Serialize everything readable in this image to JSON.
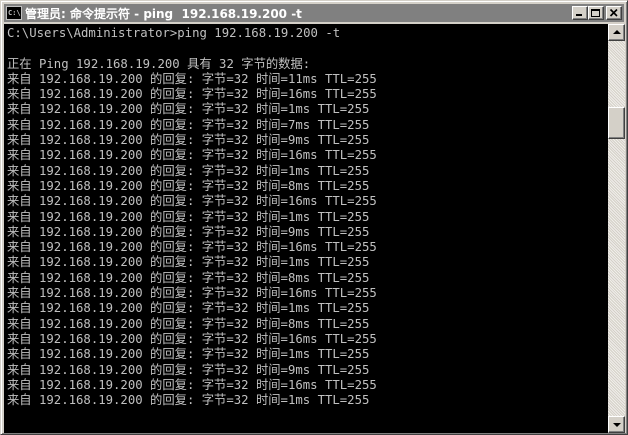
{
  "window": {
    "icon_text": "C:\\",
    "title": "管理员: 命令提示符 - ping  192.168.19.200 -t"
  },
  "console": {
    "lines": [
      "C:\\Users\\Administrator>ping 192.168.19.200 -t",
      "",
      "正在 Ping 192.168.19.200 具有 32 字节的数据:",
      "来自 192.168.19.200 的回复: 字节=32 时间=11ms TTL=255",
      "来自 192.168.19.200 的回复: 字节=32 时间=16ms TTL=255",
      "来自 192.168.19.200 的回复: 字节=32 时间=1ms TTL=255",
      "来自 192.168.19.200 的回复: 字节=32 时间=7ms TTL=255",
      "来自 192.168.19.200 的回复: 字节=32 时间=9ms TTL=255",
      "来自 192.168.19.200 的回复: 字节=32 时间=16ms TTL=255",
      "来自 192.168.19.200 的回复: 字节=32 时间=1ms TTL=255",
      "来自 192.168.19.200 的回复: 字节=32 时间=8ms TTL=255",
      "来自 192.168.19.200 的回复: 字节=32 时间=16ms TTL=255",
      "来自 192.168.19.200 的回复: 字节=32 时间=1ms TTL=255",
      "来自 192.168.19.200 的回复: 字节=32 时间=9ms TTL=255",
      "来自 192.168.19.200 的回复: 字节=32 时间=16ms TTL=255",
      "来自 192.168.19.200 的回复: 字节=32 时间=1ms TTL=255",
      "来自 192.168.19.200 的回复: 字节=32 时间=8ms TTL=255",
      "来自 192.168.19.200 的回复: 字节=32 时间=16ms TTL=255",
      "来自 192.168.19.200 的回复: 字节=32 时间=1ms TTL=255",
      "来自 192.168.19.200 的回复: 字节=32 时间=8ms TTL=255",
      "来自 192.168.19.200 的回复: 字节=32 时间=16ms TTL=255",
      "来自 192.168.19.200 的回复: 字节=32 时间=1ms TTL=255",
      "来自 192.168.19.200 的回复: 字节=32 时间=9ms TTL=255",
      "来自 192.168.19.200 的回复: 字节=32 时间=16ms TTL=255",
      "来自 192.168.19.200 的回复: 字节=32 时间=1ms TTL=255"
    ]
  },
  "colors": {
    "console_background": "#000000",
    "console_text": "#c0c0c0",
    "titlebar_inactive": "#808080",
    "window_chrome": "#d4d0c8"
  }
}
